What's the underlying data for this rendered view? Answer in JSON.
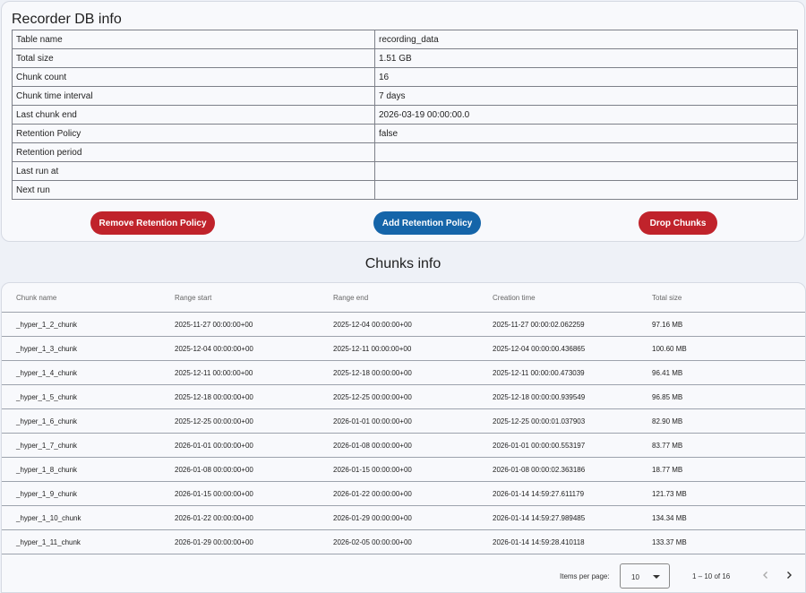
{
  "db_info": {
    "title": "Recorder DB info",
    "rows": [
      {
        "key": "Table name",
        "value": "recording_data"
      },
      {
        "key": "Total size",
        "value": "1.51 GB"
      },
      {
        "key": "Chunk count",
        "value": "16"
      },
      {
        "key": "Chunk time interval",
        "value": "7 days"
      },
      {
        "key": "Last chunk end",
        "value": "2026-03-19 00:00:00.0"
      },
      {
        "key": "Retention Policy",
        "value": "false"
      },
      {
        "key": "Retention period",
        "value": ""
      },
      {
        "key": "Last run at",
        "value": ""
      },
      {
        "key": "Next run",
        "value": ""
      }
    ],
    "buttons": {
      "remove_retention": "Remove Retention Policy",
      "add_retention": "Add Retention Policy",
      "drop_chunks": "Drop Chunks"
    }
  },
  "chunks": {
    "title": "Chunks info",
    "columns": [
      "Chunk name",
      "Range start",
      "Range end",
      "Creation time",
      "Total size"
    ],
    "rows": [
      [
        "_hyper_1_2_chunk",
        "2025-11-27 00:00:00+00",
        "2025-12-04 00:00:00+00",
        "2025-11-27 00:00:02.062259",
        "97.16 MB"
      ],
      [
        "_hyper_1_3_chunk",
        "2025-12-04 00:00:00+00",
        "2025-12-11 00:00:00+00",
        "2025-12-04 00:00:00.436865",
        "100.60 MB"
      ],
      [
        "_hyper_1_4_chunk",
        "2025-12-11 00:00:00+00",
        "2025-12-18 00:00:00+00",
        "2025-12-11 00:00:00.473039",
        "96.41 MB"
      ],
      [
        "_hyper_1_5_chunk",
        "2025-12-18 00:00:00+00",
        "2025-12-25 00:00:00+00",
        "2025-12-18 00:00:00.939549",
        "96.85 MB"
      ],
      [
        "_hyper_1_6_chunk",
        "2025-12-25 00:00:00+00",
        "2026-01-01 00:00:00+00",
        "2025-12-25 00:00:01.037903",
        "82.90 MB"
      ],
      [
        "_hyper_1_7_chunk",
        "2026-01-01 00:00:00+00",
        "2026-01-08 00:00:00+00",
        "2026-01-01 00:00:00.553197",
        "83.77 MB"
      ],
      [
        "_hyper_1_8_chunk",
        "2026-01-08 00:00:00+00",
        "2026-01-15 00:00:00+00",
        "2026-01-08 00:00:02.363186",
        "18.77 MB"
      ],
      [
        "_hyper_1_9_chunk",
        "2026-01-15 00:00:00+00",
        "2026-01-22 00:00:00+00",
        "2026-01-14 14:59:27.611179",
        "121.73 MB"
      ],
      [
        "_hyper_1_10_chunk",
        "2026-01-22 00:00:00+00",
        "2026-01-29 00:00:00+00",
        "2026-01-14 14:59:27.989485",
        "134.34 MB"
      ],
      [
        "_hyper_1_11_chunk",
        "2026-01-29 00:00:00+00",
        "2026-02-05 00:00:00+00",
        "2026-01-14 14:59:28.410118",
        "133.37 MB"
      ]
    ],
    "paginator": {
      "items_per_page_label": "Items per page:",
      "items_per_page_value": "10",
      "range_label": "1 – 10 of 16"
    }
  },
  "icons": {
    "dropdown": "chevron-down-icon",
    "prev": "chevron-left-icon",
    "next": "chevron-right-icon"
  },
  "colors": {
    "danger": "#c0232b",
    "primary": "#1565a9"
  }
}
